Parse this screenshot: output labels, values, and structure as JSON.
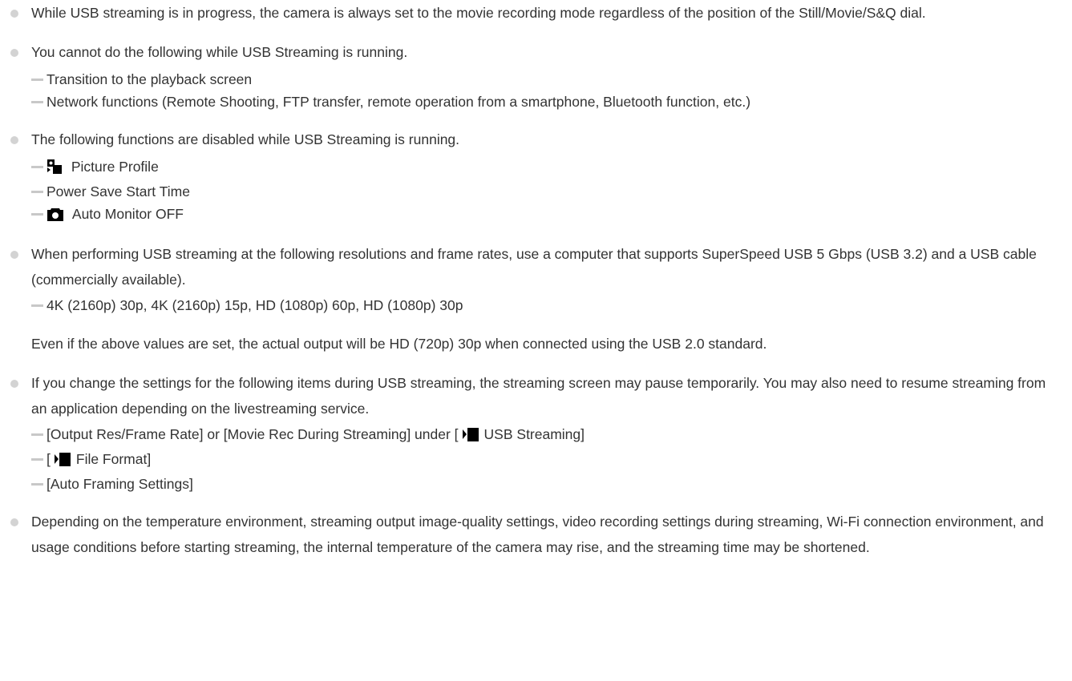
{
  "notes": [
    {
      "text": "While USB streaming is in progress, the camera is always set to the movie recording mode regardless of the position of the Still/Movie/S&Q dial."
    },
    {
      "text": "You cannot do the following while USB Streaming is running.",
      "items": [
        "Transition to the playback screen",
        "Network functions (Remote Shooting, FTP transfer, remote operation from a smartphone, Bluetooth function, etc.)"
      ]
    },
    {
      "text": "The following functions are disabled while USB Streaming is running.",
      "items": [
        {
          "icon": "picture-profile-icon",
          "label": "Picture Profile"
        },
        {
          "label": "Power Save Start Time"
        },
        {
          "icon": "camera-icon",
          "label": "Auto Monitor OFF"
        }
      ]
    },
    {
      "text": "When performing USB streaming at the following resolutions and frame rates, use a computer that supports SuperSpeed USB 5 Gbps (USB 3.2) and a USB cable (commercially available).",
      "items": [
        "4K (2160p) 30p, 4K (2160p) 15p, HD (1080p) 60p, HD (1080p) 30p"
      ],
      "extra": "Even if the above values are set, the actual output will be HD (720p) 30p when connected using the USB 2.0 standard."
    },
    {
      "text": "If you change the settings for the following items during USB streaming, the streaming screen may pause temporarily. You may also need to resume streaming from an application depending on the livestreaming service.",
      "items": [
        {
          "before": "[Output Res/Frame Rate] or [Movie Rec During Streaming] under [",
          "icon": "movie-icon",
          "after": "USB Streaming]"
        },
        {
          "before": "[",
          "icon": "movie-icon",
          "after": "File Format]"
        },
        {
          "before": "[Auto Framing Settings]"
        }
      ]
    },
    {
      "text": "Depending on the temperature environment, streaming output image-quality settings, video recording settings during streaming, Wi-Fi connection environment, and usage conditions before starting streaming, the internal temperature of the camera may rise, and the streaming time may be shortened."
    }
  ]
}
